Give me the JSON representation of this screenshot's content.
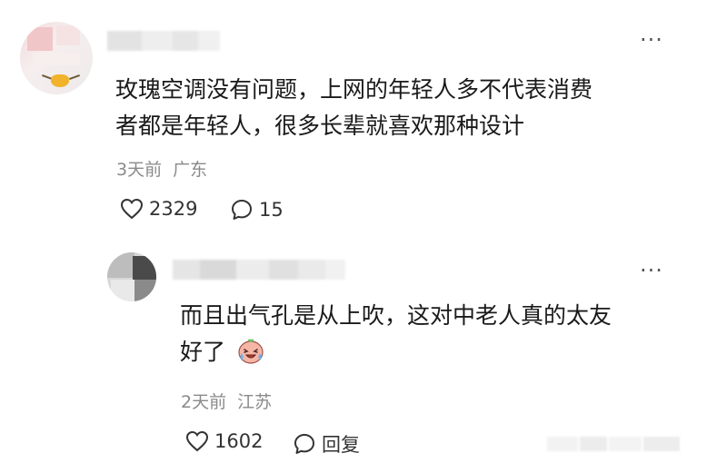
{
  "comment": {
    "text_line1": "玫瑰空调没有问题，上网的年轻人多不代表消费",
    "text_line2": "者都是年轻人，很多长辈就喜欢那种设计",
    "time": "3天前",
    "location": "广东",
    "likes": "2329",
    "replies": "15"
  },
  "reply": {
    "text_line1": "而且出气孔是从上吹，这对中老人真的太友",
    "text_line2": "好了",
    "emoji_icon": "crying-laughing-emoji",
    "time": "2天前",
    "location": "江苏",
    "likes": "1602",
    "reply_label": "回复"
  },
  "more_label": "···",
  "colors": {
    "text": "#1a1a1a",
    "meta": "#8a8a8a",
    "icon": "#333333"
  }
}
